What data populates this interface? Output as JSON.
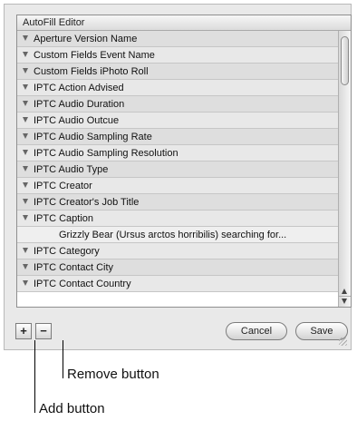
{
  "list": {
    "header": "AutoFill Editor",
    "rows": [
      {
        "label": "Aperture Version Name",
        "type": "item"
      },
      {
        "label": "Custom Fields Event Name",
        "type": "item"
      },
      {
        "label": "Custom Fields iPhoto Roll",
        "type": "item"
      },
      {
        "label": "IPTC Action Advised",
        "type": "item"
      },
      {
        "label": "IPTC Audio Duration",
        "type": "item"
      },
      {
        "label": "IPTC Audio Outcue",
        "type": "item"
      },
      {
        "label": "IPTC Audio Sampling Rate",
        "type": "item"
      },
      {
        "label": "IPTC Audio Sampling Resolution",
        "type": "item"
      },
      {
        "label": "IPTC Audio Type",
        "type": "item"
      },
      {
        "label": "IPTC Creator",
        "type": "item"
      },
      {
        "label": "IPTC Creator's Job Title",
        "type": "item"
      },
      {
        "label": "IPTC Caption",
        "type": "item"
      },
      {
        "label": "Grizzly Bear (Ursus arctos horribilis) searching for...",
        "type": "detail"
      },
      {
        "label": "IPTC Category",
        "type": "item"
      },
      {
        "label": "IPTC Contact City",
        "type": "item"
      },
      {
        "label": "IPTC Contact Country",
        "type": "item"
      }
    ]
  },
  "buttons": {
    "add_label": "+",
    "remove_label": "−",
    "cancel_label": "Cancel",
    "save_label": "Save"
  },
  "callouts": {
    "remove": "Remove button",
    "add": "Add button"
  },
  "icons": {
    "disclosure": "disclosure-triangle-icon",
    "scroll_up": "scroll-up-arrow-icon",
    "scroll_down": "scroll-down-arrow-icon",
    "resize": "resize-grip-icon"
  }
}
